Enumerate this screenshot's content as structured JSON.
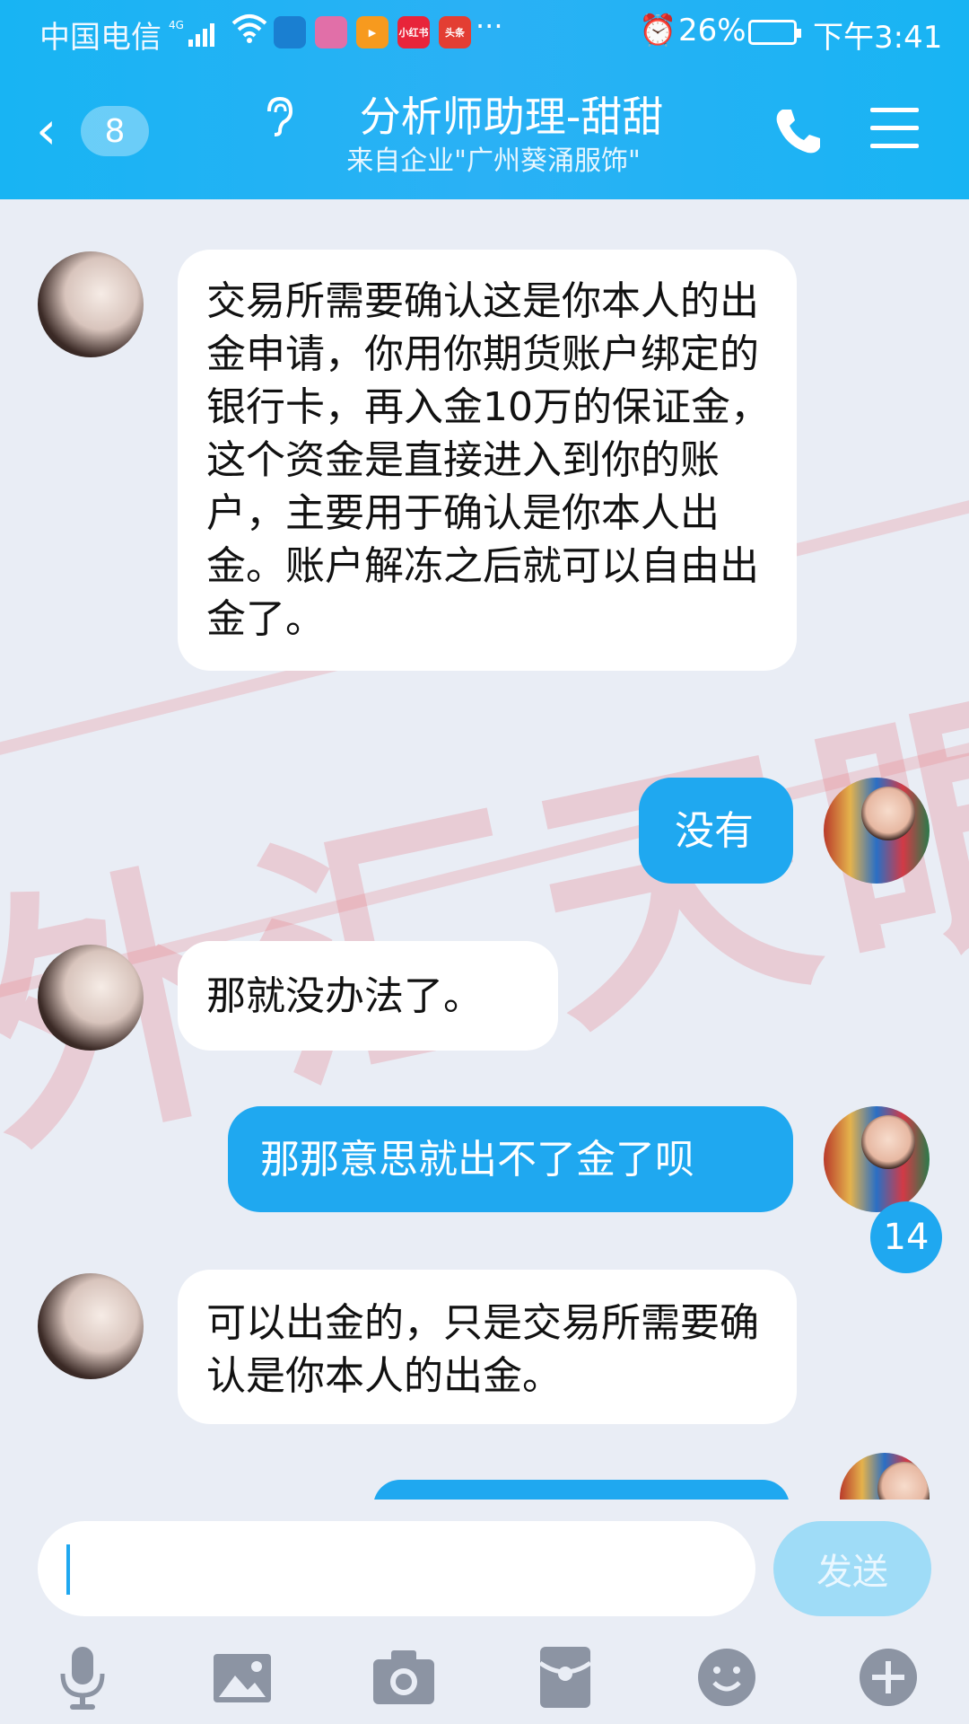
{
  "status_bar": {
    "carrier": "中国电信",
    "network": "4G",
    "apps": [
      {
        "icon": "blue-app-icon",
        "label": "",
        "color": "#1a7fd1"
      },
      {
        "icon": "flower-app-icon",
        "label": "",
        "color": "#e16fa8"
      },
      {
        "icon": "video-app-icon",
        "label": "",
        "color": "#f79a1e"
      },
      {
        "icon": "xiaohongshu-app-icon",
        "label": "小红书",
        "color": "#e8243a"
      },
      {
        "icon": "toutiao-app-icon",
        "label": "头条",
        "color": "#e33e33"
      }
    ],
    "more": "···",
    "battery_pct": "26%",
    "time": "下午3:41"
  },
  "header": {
    "back_count": "8",
    "title": "分析师助理-甜甜",
    "subtitle": "来自企业\"广州葵涌服饰\""
  },
  "messages": [
    {
      "from": "them",
      "text": "交易所需要确认这是你本人的出金申请，你用你期货账户绑定的银行卡，再入金10万的保证金，这个资金是直接进入到你的账户，主要用于确认是你本人出金。账户解冻之后就可以自由出金了。"
    },
    {
      "from": "me",
      "text": "没有"
    },
    {
      "from": "them",
      "text": "那就没办法了。"
    },
    {
      "from": "me",
      "text": "那那意思就出不了金了呗"
    },
    {
      "from": "them",
      "text": "可以出金的，只是交易所需要确认是你本人的出金。"
    }
  ],
  "unread_count": "14",
  "input": {
    "placeholder": "",
    "value": "",
    "send_label": "发送"
  },
  "toolbar": [
    "microphone-icon",
    "image-icon",
    "camera-icon",
    "red-packet-icon",
    "emoji-icon",
    "plus-icon"
  ],
  "colors": {
    "accent": "#1fa8f0",
    "header": "#18b4f3",
    "background": "#e9edf5"
  }
}
